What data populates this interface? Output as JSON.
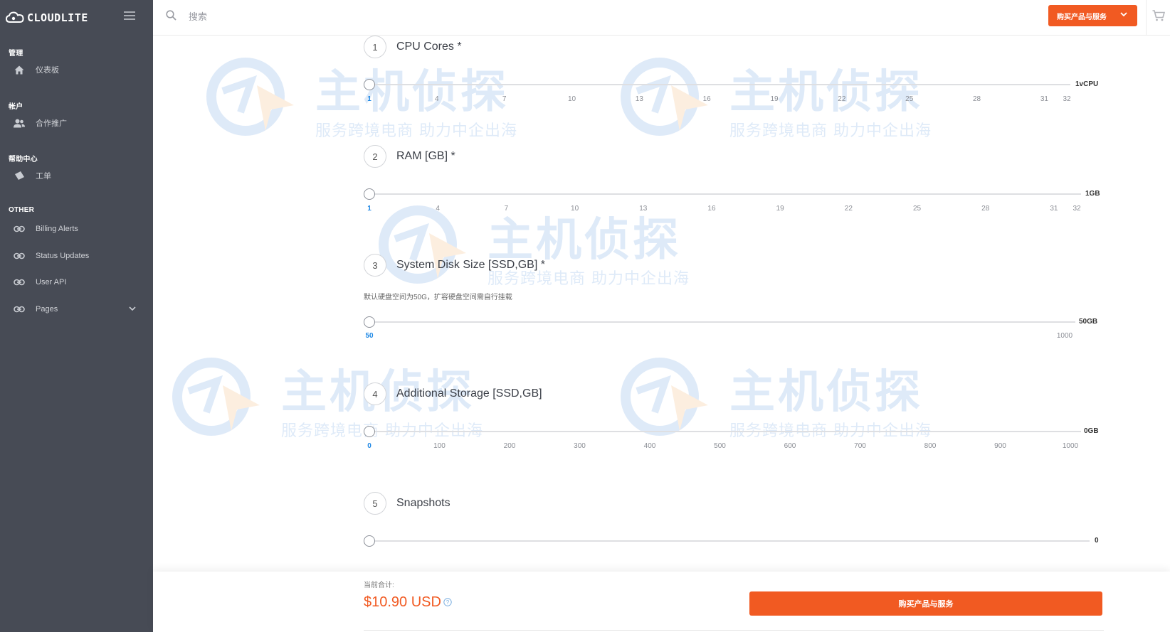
{
  "brand": {
    "name": "CLOUDLITE",
    "logo_icon": "cloud-icon"
  },
  "sidebar": {
    "sections": [
      {
        "title": "管理",
        "items": [
          {
            "label": "仪表板",
            "icon": "home-icon"
          }
        ]
      },
      {
        "title": "帐户",
        "items": [
          {
            "label": "合作推广",
            "icon": "users-icon"
          }
        ]
      },
      {
        "title": "帮助中心",
        "items": [
          {
            "label": "工单",
            "icon": "ticket-icon"
          }
        ]
      },
      {
        "title": "OTHER",
        "items": [
          {
            "label": "Billing Alerts",
            "icon": "link-icon"
          },
          {
            "label": "Status Updates",
            "icon": "link-icon"
          },
          {
            "label": "User API",
            "icon": "link-icon"
          },
          {
            "label": "Pages",
            "icon": "link-icon",
            "expandable": true
          }
        ]
      }
    ]
  },
  "topbar": {
    "search_placeholder": "搜索",
    "buy_label": "购买产品与服务"
  },
  "steps": [
    {
      "num": "1",
      "title": "CPU Cores *",
      "value_label": "1vCPU",
      "value": 1,
      "ticks": [
        "1",
        "4",
        "7",
        "10",
        "13",
        "16",
        "19",
        "22",
        "25",
        "28",
        "31",
        "32"
      ]
    },
    {
      "num": "2",
      "title": "RAM [GB] *",
      "value_label": "1GB",
      "value": 1,
      "ticks": [
        "1",
        "4",
        "7",
        "10",
        "13",
        "16",
        "19",
        "22",
        "25",
        "28",
        "31",
        "32"
      ]
    },
    {
      "num": "3",
      "title": "System Disk Size [SSD,GB] *",
      "note": "默认硬盘空间为50G，扩容硬盘空间需自行挂载",
      "value_label": "50GB",
      "value": 50,
      "ticks": [
        "50",
        "1000"
      ]
    },
    {
      "num": "4",
      "title": "Additional Storage [SSD,GB]",
      "value_label": "0GB",
      "value": 0,
      "ticks": [
        "0",
        "100",
        "200",
        "300",
        "400",
        "500",
        "600",
        "700",
        "800",
        "900",
        "1000"
      ]
    },
    {
      "num": "5",
      "title": "Snapshots",
      "value_label": "0",
      "value": 0,
      "ticks": []
    }
  ],
  "footer": {
    "total_label": "当前合计:",
    "total_value": "$10.90 USD",
    "buy_label": "购买产品与服务"
  },
  "watermark": {
    "title": "主机侦探",
    "subtitle": "服务跨境电商 助力中企出海"
  },
  "colors": {
    "sidebar_bg": "#474b55",
    "accent": "#f15a22",
    "tick_active": "#1e88e5"
  }
}
